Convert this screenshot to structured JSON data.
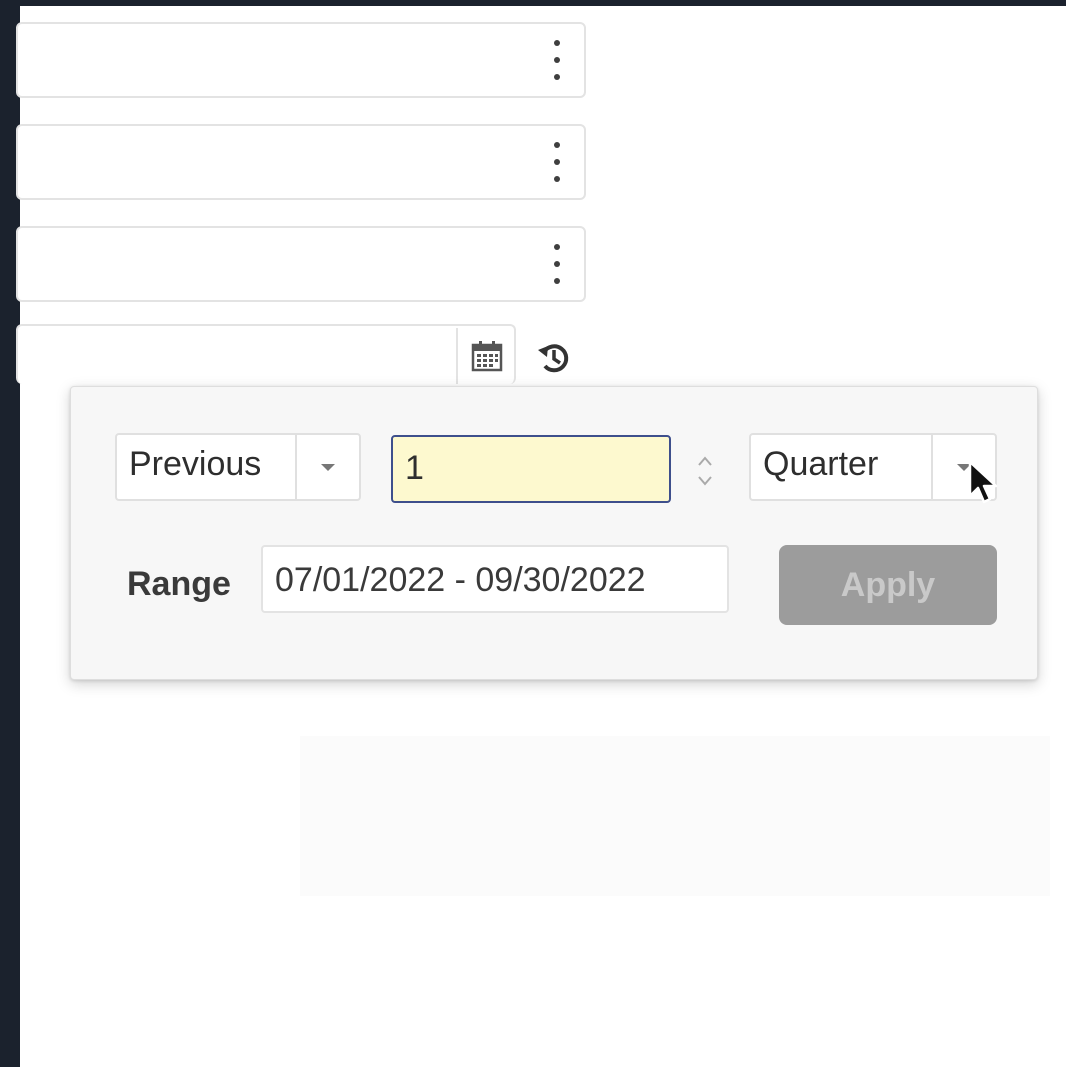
{
  "popover": {
    "direction_select": {
      "value": "Previous"
    },
    "count_input": {
      "value": "1"
    },
    "unit_select": {
      "value": "Quarter"
    },
    "range_label": "Range",
    "range_value": "07/01/2022 - 09/30/2022",
    "apply_label": "Apply"
  },
  "icons": {
    "row_menu": "kebab-menu-icon",
    "calendar": "calendar-icon",
    "history": "history-icon",
    "dropdown": "chevron-down-icon",
    "spinner": "up-down-spinner-icon",
    "cursor": "mouse-pointer-icon"
  },
  "colors": {
    "frame_background": "#1b222d",
    "input_highlight": "#fdf9cf",
    "input_focus_border": "#3e4f8c",
    "apply_disabled": "#9c9c9c"
  }
}
